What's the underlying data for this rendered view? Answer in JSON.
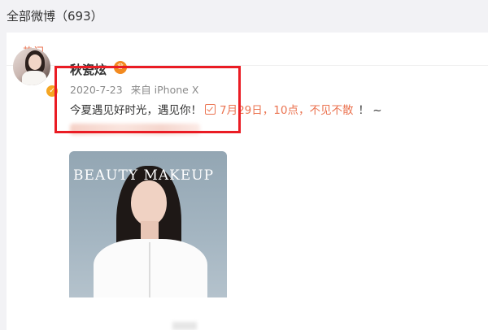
{
  "header": {
    "title": "全部微博（693）"
  },
  "tabs": {
    "hot": "热门"
  },
  "post": {
    "user_name": "秋瓷炫",
    "verified": true,
    "vip_icon": "crown-icon",
    "date": "2020-7-23",
    "source": "来自 iPhone X",
    "text_prefix": "今夏遇见好时光，遇见你！",
    "event_icon": "check-calendar-icon",
    "text_highlight": "7月29日，10点，不见不散",
    "text_suffix": "！ ~",
    "image_caption": "BEAUTY MAKEUP"
  },
  "colors": {
    "accent": "#eb7350",
    "annotation": "#ea1c24",
    "text": "#333333",
    "meta": "#8a8a8a"
  }
}
